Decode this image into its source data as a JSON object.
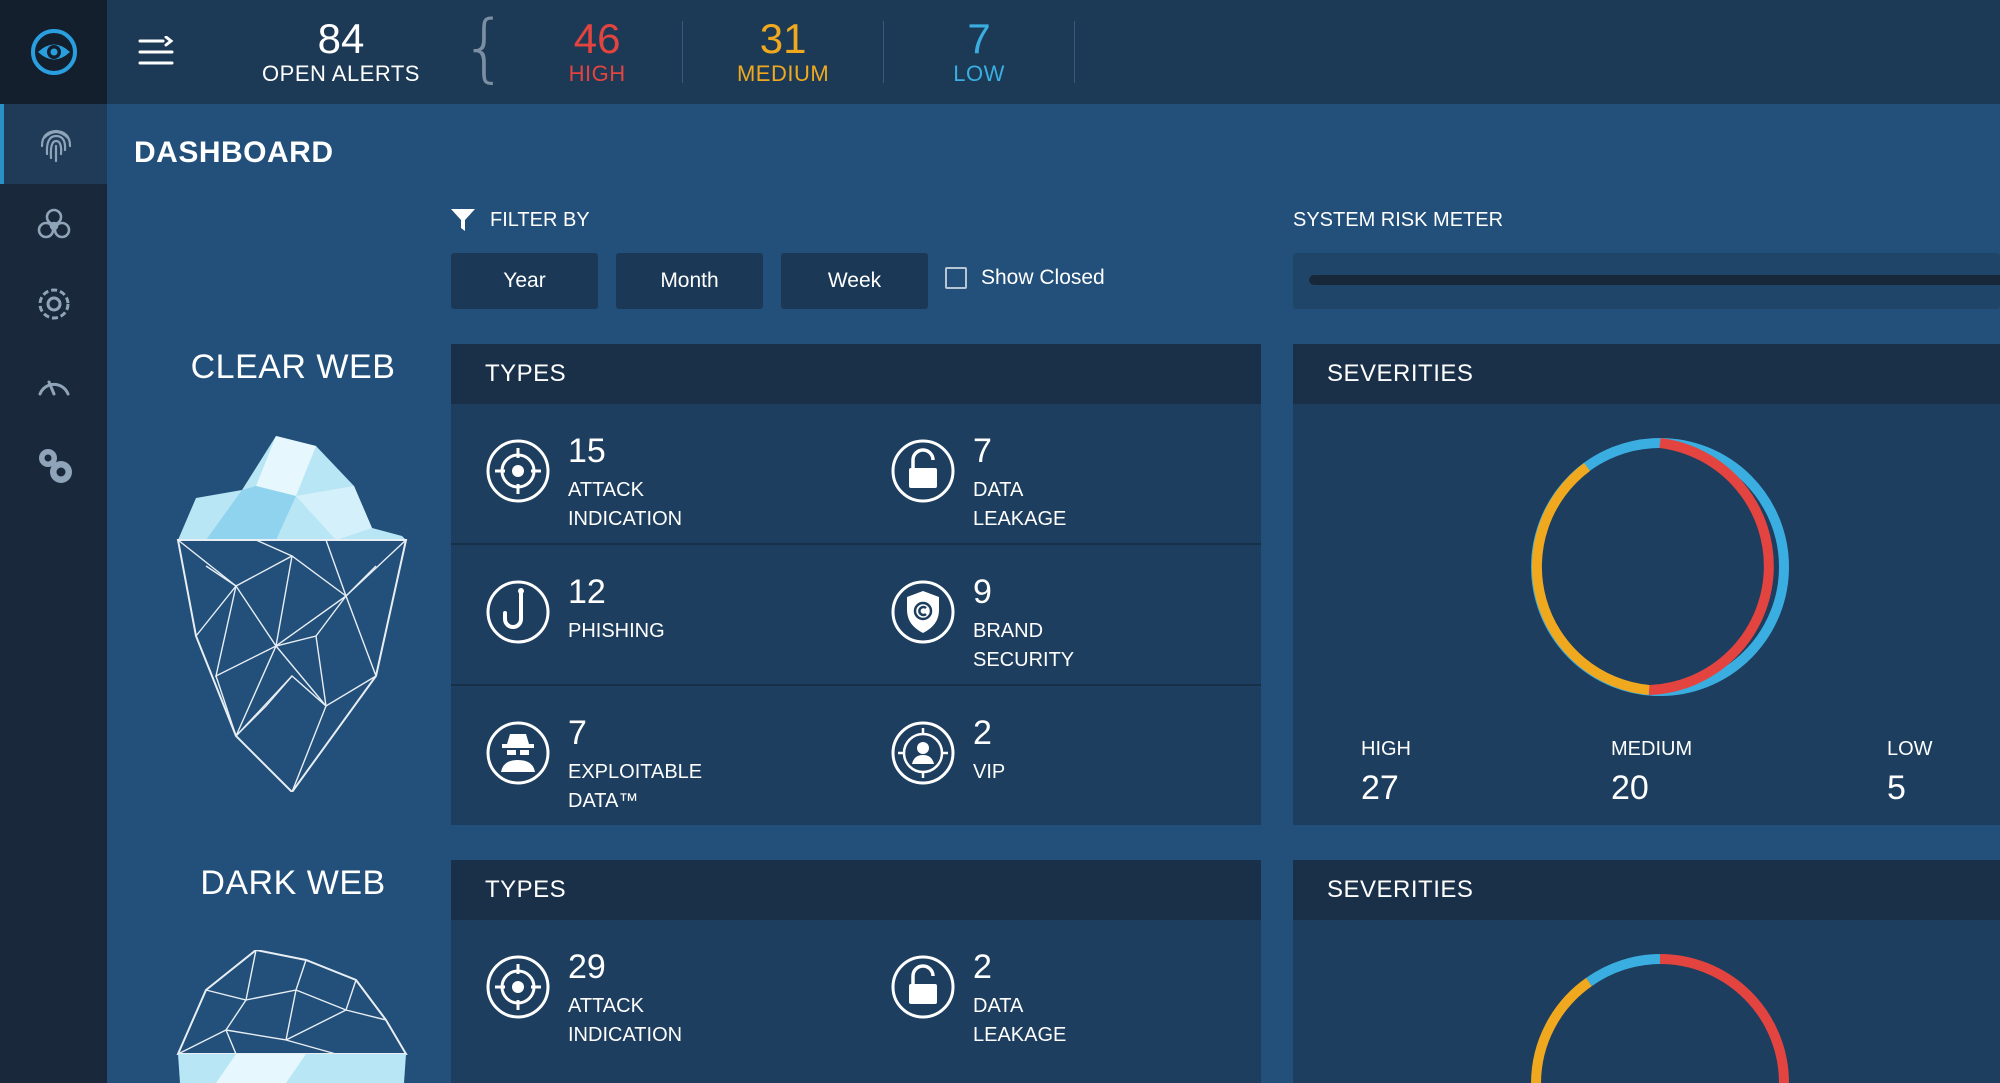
{
  "topbar": {
    "open_alerts": {
      "count": "84",
      "label": "OPEN ALERTS"
    },
    "high": {
      "count": "46",
      "label": "HIGH"
    },
    "medium": {
      "count": "31",
      "label": "MEDIUM"
    },
    "low": {
      "count": "7",
      "label": "LOW"
    }
  },
  "sidebar": {
    "items": [
      {
        "icon": "fingerprint-icon",
        "active": true
      },
      {
        "icon": "biohazard-icon",
        "active": false
      },
      {
        "icon": "target-settings-icon",
        "active": false
      },
      {
        "icon": "gauge-icon",
        "active": false
      },
      {
        "icon": "gears-icon",
        "active": false
      }
    ]
  },
  "page": {
    "title": "DASHBOARD"
  },
  "filter": {
    "label": "FILTER BY",
    "buttons": [
      "Year",
      "Month",
      "Week"
    ],
    "show_closed": "Show Closed"
  },
  "risk_meter": {
    "label": "SYSTEM RISK METER"
  },
  "clear_web": {
    "label": "CLEAR WEB",
    "types_title": "TYPES",
    "types": [
      {
        "count": "15",
        "label": "ATTACK INDICATION",
        "icon": "target-icon"
      },
      {
        "count": "7",
        "label": "DATA LEAKAGE",
        "icon": "unlock-icon"
      },
      {
        "count": "12",
        "label": "PHISHING",
        "icon": "hook-icon"
      },
      {
        "count": "9",
        "label": "BRAND SECURITY",
        "icon": "shield-copyright-icon"
      },
      {
        "count": "7",
        "label": "EXPLOITABLE DATA™",
        "icon": "spy-icon"
      },
      {
        "count": "2",
        "label": "VIP",
        "icon": "vip-user-icon"
      }
    ],
    "severities_title": "SEVERITIES",
    "severities": [
      {
        "label": "HIGH",
        "count": "27"
      },
      {
        "label": "MEDIUM",
        "count": "20"
      },
      {
        "label": "LOW",
        "count": "5"
      }
    ]
  },
  "dark_web": {
    "label": "DARK WEB",
    "types_title": "TYPES",
    "types": [
      {
        "count": "29",
        "label": "ATTACK INDICATION",
        "icon": "target-icon"
      },
      {
        "count": "2",
        "label": "DATA LEAKAGE",
        "icon": "unlock-icon"
      }
    ],
    "severities_title": "SEVERITIES"
  },
  "colors": {
    "high": "#e3443f",
    "medium": "#f0a91f",
    "low": "#3aaee0"
  }
}
